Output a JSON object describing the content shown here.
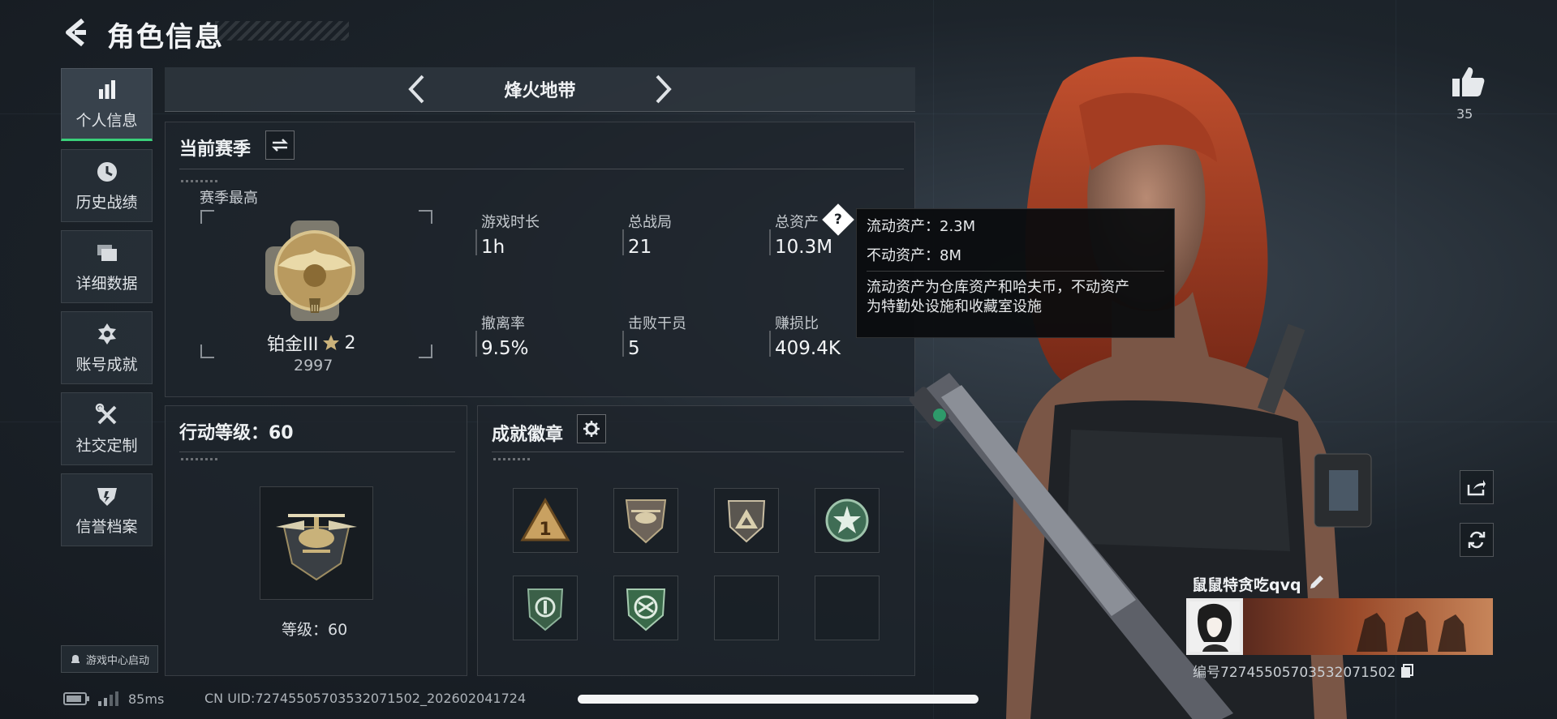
{
  "header": {
    "title": "角色信息"
  },
  "sidebar": {
    "items": [
      {
        "label": "个人信息",
        "icon": "bar-chart-icon",
        "active": true
      },
      {
        "label": "历史战绩",
        "icon": "clock-icon",
        "active": false
      },
      {
        "label": "详细数据",
        "icon": "folders-icon",
        "active": false
      },
      {
        "label": "账号成就",
        "icon": "achievement-emblem-icon",
        "active": false
      },
      {
        "label": "社交定制",
        "icon": "wrench-cross-icon",
        "active": false
      },
      {
        "label": "信誉档案",
        "icon": "credit-shield-icon",
        "active": false
      }
    ],
    "game_center": "游戏中心启动"
  },
  "mode": {
    "title": "烽火地带"
  },
  "season": {
    "title": "当前赛季",
    "best_label": "赛季最高",
    "rank_name": "铂金III",
    "rank_stars": "2",
    "rank_score": "2997",
    "stats": [
      {
        "label": "游戏时长",
        "value": "1h"
      },
      {
        "label": "总战局",
        "value": "21"
      },
      {
        "label": "总资产",
        "value": "10.3M"
      },
      {
        "label": "撤离率",
        "value": "9.5%"
      },
      {
        "label": "击败干员",
        "value": "5"
      },
      {
        "label": "赚损比",
        "value": "409.4K"
      }
    ]
  },
  "tooltip": {
    "line1": "流动资产：2.3M",
    "line2": "不动资产：8M",
    "desc1": "流动资产为仓库资产和哈夫币，不动资产",
    "desc2": "为特勤处设施和收藏室设施"
  },
  "action_level": {
    "title": "行动等级：60",
    "level_text": "等级：60"
  },
  "badges": {
    "title": "成就徽章",
    "slots": [
      "rank-one-badge",
      "helicopter-shield-badge",
      "triangle-shield-badge",
      "star-medal-badge",
      "green-shield-badge",
      "green-emblem-badge",
      "empty",
      "empty"
    ]
  },
  "player": {
    "name": "鼠鼠特贪吃qvq",
    "id_text": "编号727455057035320715​02",
    "likes": "35"
  },
  "status_bar": {
    "latency": "85ms",
    "uid": "CN UID:7274550570353207150​2_202602041724"
  },
  "colors": {
    "accent_green": "#3ad07a",
    "panel": "#1e252c",
    "tooltip_bg": "#0a0c0e"
  }
}
